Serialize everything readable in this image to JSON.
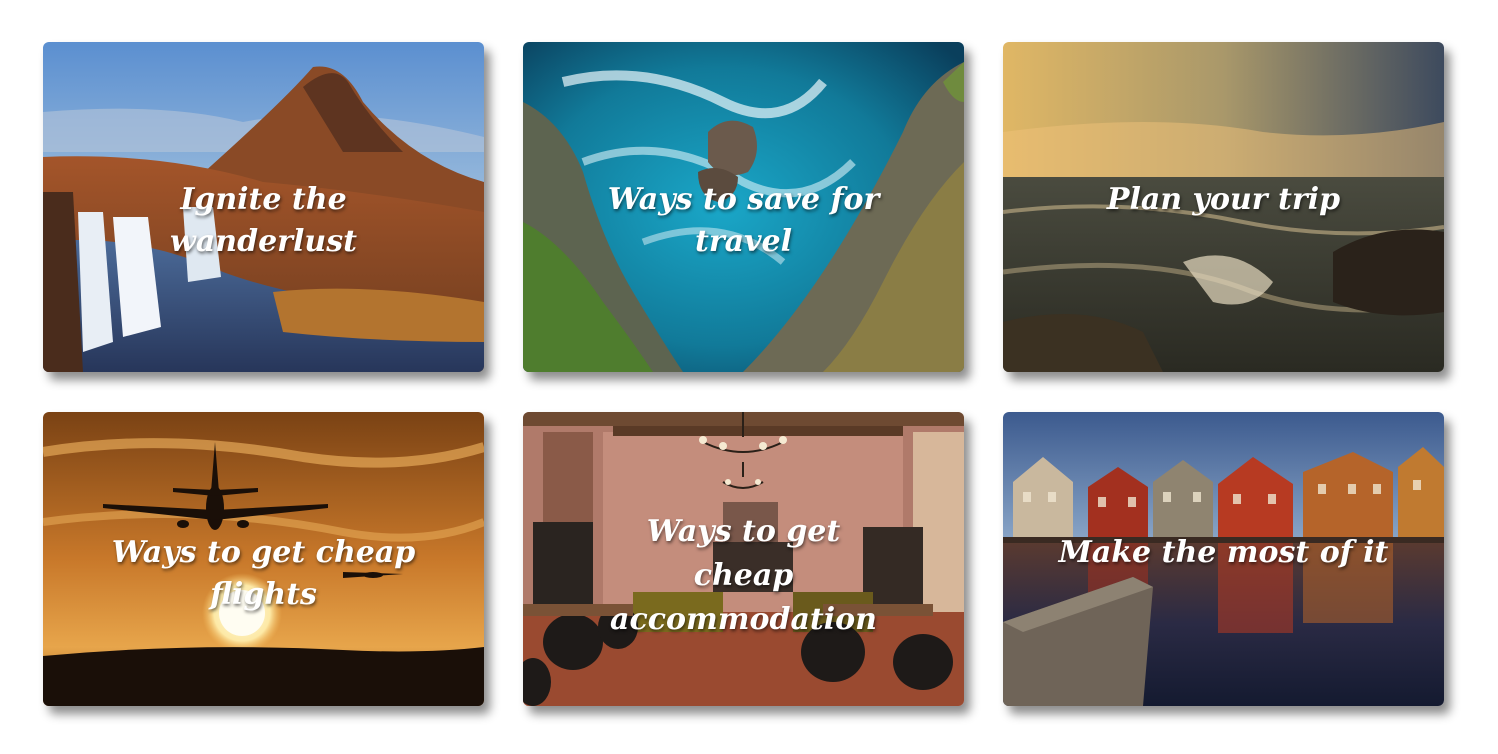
{
  "cards": [
    {
      "title": "Ignite the wanderlust",
      "image": "mountain-waterfall-landscape"
    },
    {
      "title": "Ways to save for travel",
      "image": "sea-cliffs-waves"
    },
    {
      "title": "Plan your trip",
      "image": "ocean-sunset-rocks"
    },
    {
      "title": "Ways to get cheap flights",
      "image": "airplane-sunset"
    },
    {
      "title": "Ways to get cheap accommodation",
      "image": "hotel-lounge-interior"
    },
    {
      "title": "Make the most of it",
      "image": "waterfront-houses"
    }
  ]
}
